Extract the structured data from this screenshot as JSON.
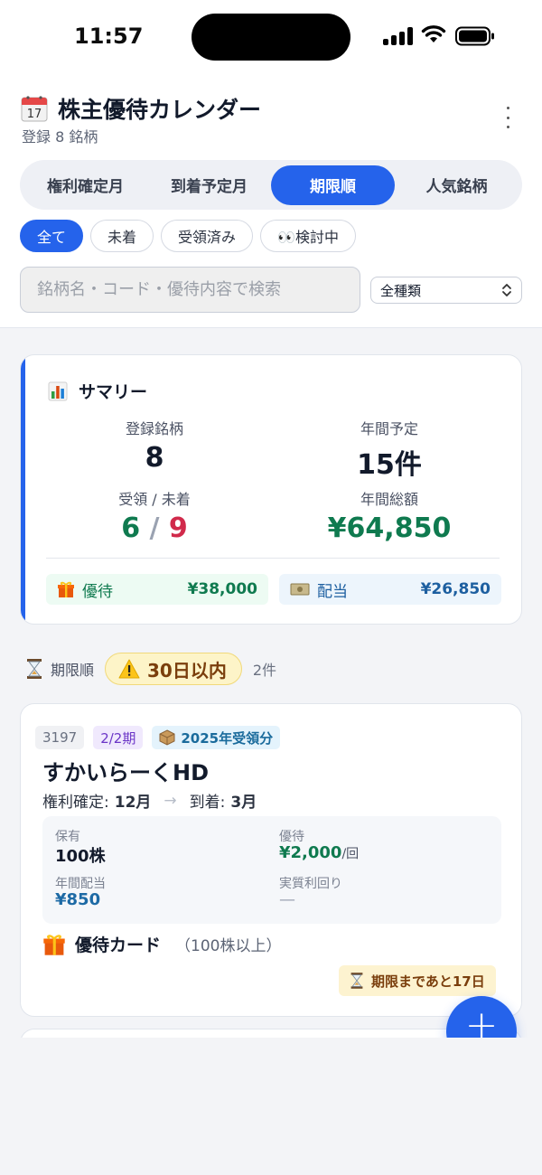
{
  "status_bar": {
    "time": "11:57"
  },
  "header": {
    "title": "株主優待カレンダー",
    "subtitle": "登録 8 銘柄",
    "tabs": [
      {
        "label": "権利確定月",
        "active": false
      },
      {
        "label": "到着予定月",
        "active": false
      },
      {
        "label": "期限順",
        "active": true
      },
      {
        "label": "人気銘柄",
        "active": false
      }
    ],
    "filters": [
      {
        "label": "全て",
        "active": true
      },
      {
        "label": "未着",
        "active": false
      },
      {
        "label": "受領済み",
        "active": false
      },
      {
        "label": "👀検討中",
        "active": false
      }
    ],
    "search_placeholder": "銘柄名・コード・優待内容で検索",
    "type_select": "全種類"
  },
  "summary": {
    "title": "サマリー",
    "registered_label": "登録銘柄",
    "registered_value": "8",
    "annual_planned_label": "年間予定",
    "annual_planned_value": "15件",
    "received_label": "受領 / 未着",
    "received_value": "6",
    "not_arrived_value": "9",
    "annual_total_label": "年間総額",
    "annual_total_value": "¥64,850",
    "yutai_label": "優待",
    "yutai_value": "¥38,000",
    "dividend_label": "配当",
    "dividend_value": "¥26,850"
  },
  "section": {
    "label": "期限順",
    "badge": "30日以内",
    "count": "2件"
  },
  "stock_card": {
    "code": "3197",
    "term": "2/2期",
    "received_tag": "2025年受領分",
    "name": "すかいらーくHD",
    "rights_label": "権利確定:",
    "rights_month": "12月",
    "arrival_label": "到着:",
    "arrival_month": "3月",
    "holding_label": "保有",
    "holding_value": "100株",
    "yutai_label": "優待",
    "yutai_value": "¥2,000",
    "yutai_unit": "/回",
    "dividend_label": "年間配当",
    "dividend_value": "¥850",
    "yield_label": "実質利回り",
    "yield_value": "—",
    "benefit_name": "優待カード",
    "benefit_condition": "（100株以上）",
    "deadline": "期限まであと17日"
  },
  "fab": {
    "label": "+"
  },
  "colors": {
    "accent": "#2563eb",
    "positive": "#0f7a4f",
    "negative": "#d12a4b",
    "warning_bg": "#fdf4c8"
  }
}
